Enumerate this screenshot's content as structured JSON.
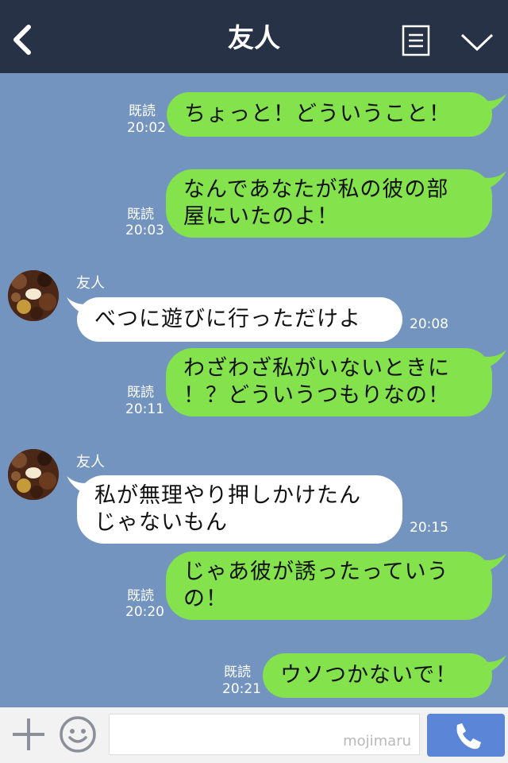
{
  "header": {
    "title": "友人"
  },
  "contact": {
    "name": "友人"
  },
  "messages": [
    {
      "side": "mine",
      "text": "ちょっと！どういうこと！",
      "status": "既読",
      "time": "20:02"
    },
    {
      "side": "mine",
      "text_lines": [
        "なんであなたが私の彼の部",
        "屋にいたのよ！"
      ],
      "status": "既読",
      "time": "20:03"
    },
    {
      "side": "theirs",
      "text": "べつに遊びに行っただけよ",
      "time": "20:08"
    },
    {
      "side": "mine",
      "text_lines": [
        "わざわざ私がいないときに",
        "！？どういうつもりなの！"
      ],
      "status": "既読",
      "time": "20:11"
    },
    {
      "side": "theirs",
      "text_lines": [
        "私が無理やり押しかけたん",
        "じゃないもん"
      ],
      "time": "20:15"
    },
    {
      "side": "mine",
      "text_lines": [
        "じゃあ彼が誘ったっていう",
        "の！"
      ],
      "status": "既読",
      "time": "20:20"
    },
    {
      "side": "mine",
      "text": "ウソつかないで！",
      "status": "既読",
      "time": "20:21"
    }
  ],
  "input": {
    "value": "",
    "watermark": "mojimaru"
  },
  "icons": {
    "back": "back-chevron-icon",
    "menu": "menu-list-icon",
    "collapse": "chevron-down-icon",
    "add": "plus-icon",
    "emoji": "smiley-icon",
    "call": "phone-icon"
  },
  "colors": {
    "header": "#273246",
    "chat_bg": "#7494c0",
    "mine_bubble": "#84e24c",
    "theirs_bubble": "#ffffff",
    "send": "#5b86d8"
  }
}
